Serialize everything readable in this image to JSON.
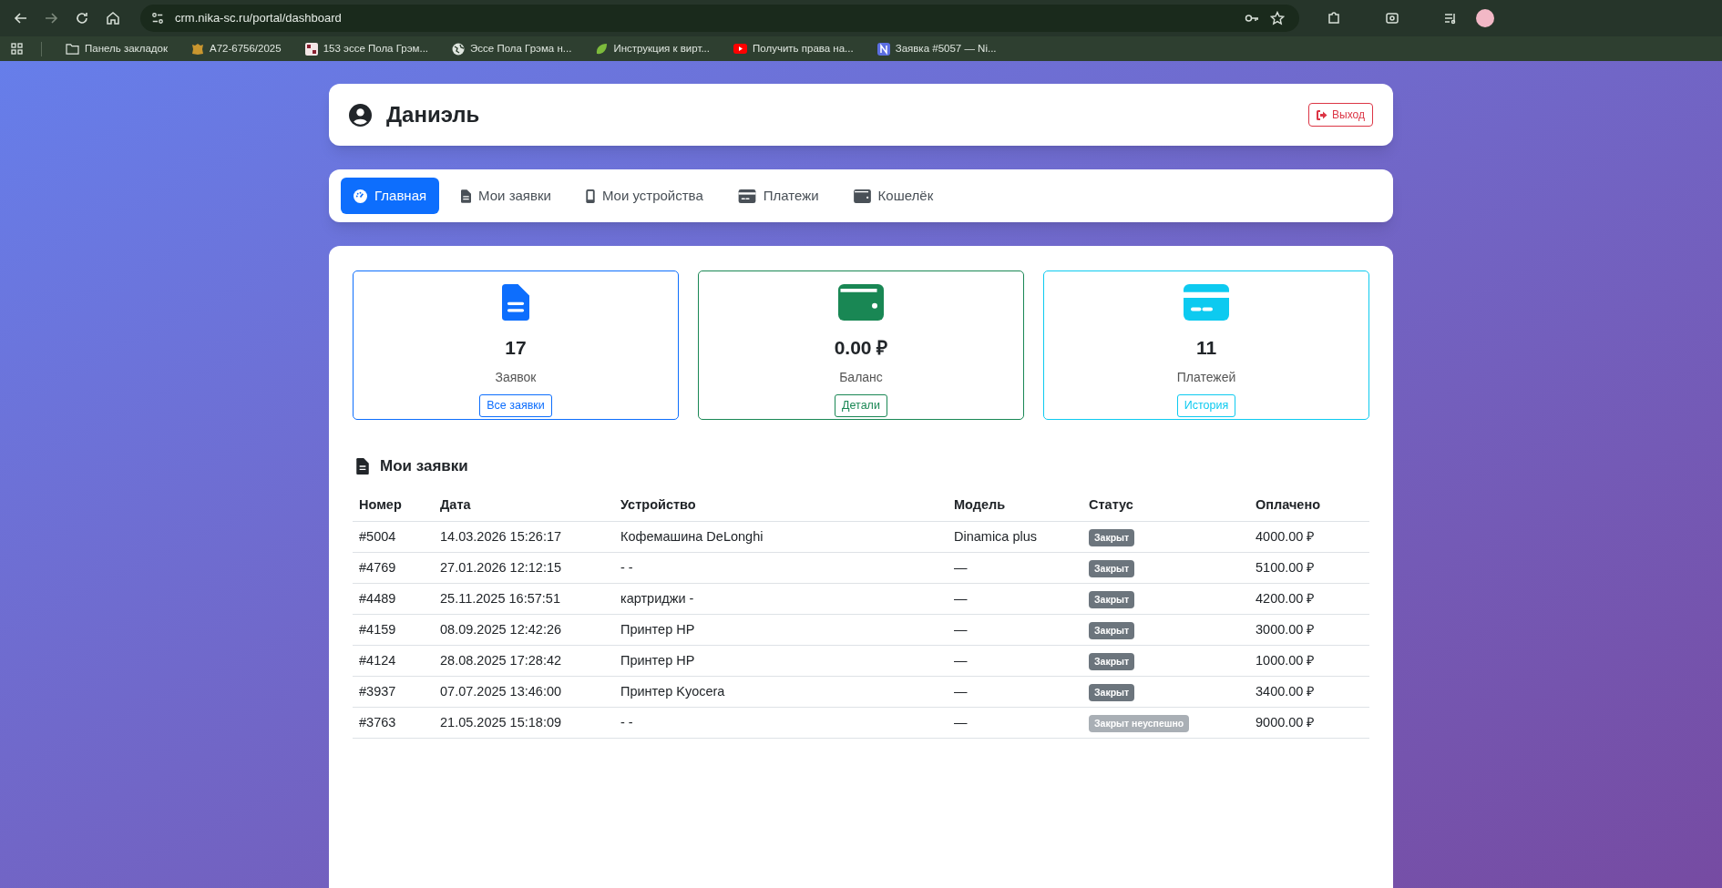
{
  "browser": {
    "url": "crm.nika-sc.ru/portal/dashboard",
    "bookmarks": [
      {
        "label": "Панель закладок",
        "kind": "folder"
      },
      {
        "label": "А72-6756/2025",
        "kind": "emblem"
      },
      {
        "label": "153 эссе Пола Грэм...",
        "kind": "tile"
      },
      {
        "label": "Эссе Пола Грэма н...",
        "kind": "globe"
      },
      {
        "label": "Инструкция к вирт...",
        "kind": "leaf"
      },
      {
        "label": "Получить права на...",
        "kind": "video"
      },
      {
        "label": "Заявка #5057 — Ni...",
        "kind": "letter"
      }
    ]
  },
  "header": {
    "user": "Даниэль",
    "logout": "Выход"
  },
  "tabs": [
    {
      "label": "Главная",
      "kind": "gauge",
      "selected": true
    },
    {
      "label": "Мои заявки",
      "kind": "file",
      "selected": false
    },
    {
      "label": "Мои устройства",
      "kind": "phone",
      "selected": false
    },
    {
      "label": "Платежи",
      "kind": "card",
      "selected": false
    },
    {
      "label": "Кошелёк",
      "kind": "wallet",
      "selected": false
    }
  ],
  "stats": [
    {
      "kind": "file",
      "color": "#0d6efd",
      "value": "17",
      "label": "Заявок",
      "button": "Все заявки"
    },
    {
      "kind": "wallet",
      "color": "#198754",
      "value": "0.00 ₽",
      "label": "Баланс",
      "button": "Детали"
    },
    {
      "kind": "card",
      "color": "#0dcaf0",
      "value": "11",
      "label": "Платежей",
      "button": "История"
    }
  ],
  "table": {
    "title": "Мои заявки",
    "columns": [
      "Номер",
      "Дата",
      "Устройство",
      "Модель",
      "Статус",
      "Оплачено"
    ],
    "rows": [
      {
        "number": "#5004",
        "date": "14.03.2026 15:26:17",
        "device": "Кофемашина DeLonghi",
        "model": "Dinamica plus",
        "status": {
          "text": "Закрыт",
          "kind": "closed"
        },
        "paid": "4000.00 ₽"
      },
      {
        "number": "#4769",
        "date": "27.01.2026 12:12:15",
        "device": "- -",
        "model": "—",
        "status": {
          "text": "Закрыт",
          "kind": "closed"
        },
        "paid": "5100.00 ₽"
      },
      {
        "number": "#4489",
        "date": "25.11.2025 16:57:51",
        "device": "картриджи -",
        "model": "—",
        "status": {
          "text": "Закрыт",
          "kind": "closed"
        },
        "paid": "4200.00 ₽"
      },
      {
        "number": "#4159",
        "date": "08.09.2025 12:42:26",
        "device": "Принтер HP",
        "model": "—",
        "status": {
          "text": "Закрыт",
          "kind": "closed"
        },
        "paid": "3000.00 ₽"
      },
      {
        "number": "#4124",
        "date": "28.08.2025 17:28:42",
        "device": "Принтер HP",
        "model": "—",
        "status": {
          "text": "Закрыт",
          "kind": "closed"
        },
        "paid": "1000.00 ₽"
      },
      {
        "number": "#3937",
        "date": "07.07.2025 13:46:00",
        "device": "Принтер Kyocera",
        "model": "—",
        "status": {
          "text": "Закрыт",
          "kind": "closed"
        },
        "paid": "3400.00 ₽"
      },
      {
        "number": "#3763",
        "date": "21.05.2025 15:18:09",
        "device": "- -",
        "model": "—",
        "status": {
          "text": "Закрыт неуспешно",
          "kind": "failed"
        },
        "paid": "9000.00 ₽"
      }
    ]
  }
}
